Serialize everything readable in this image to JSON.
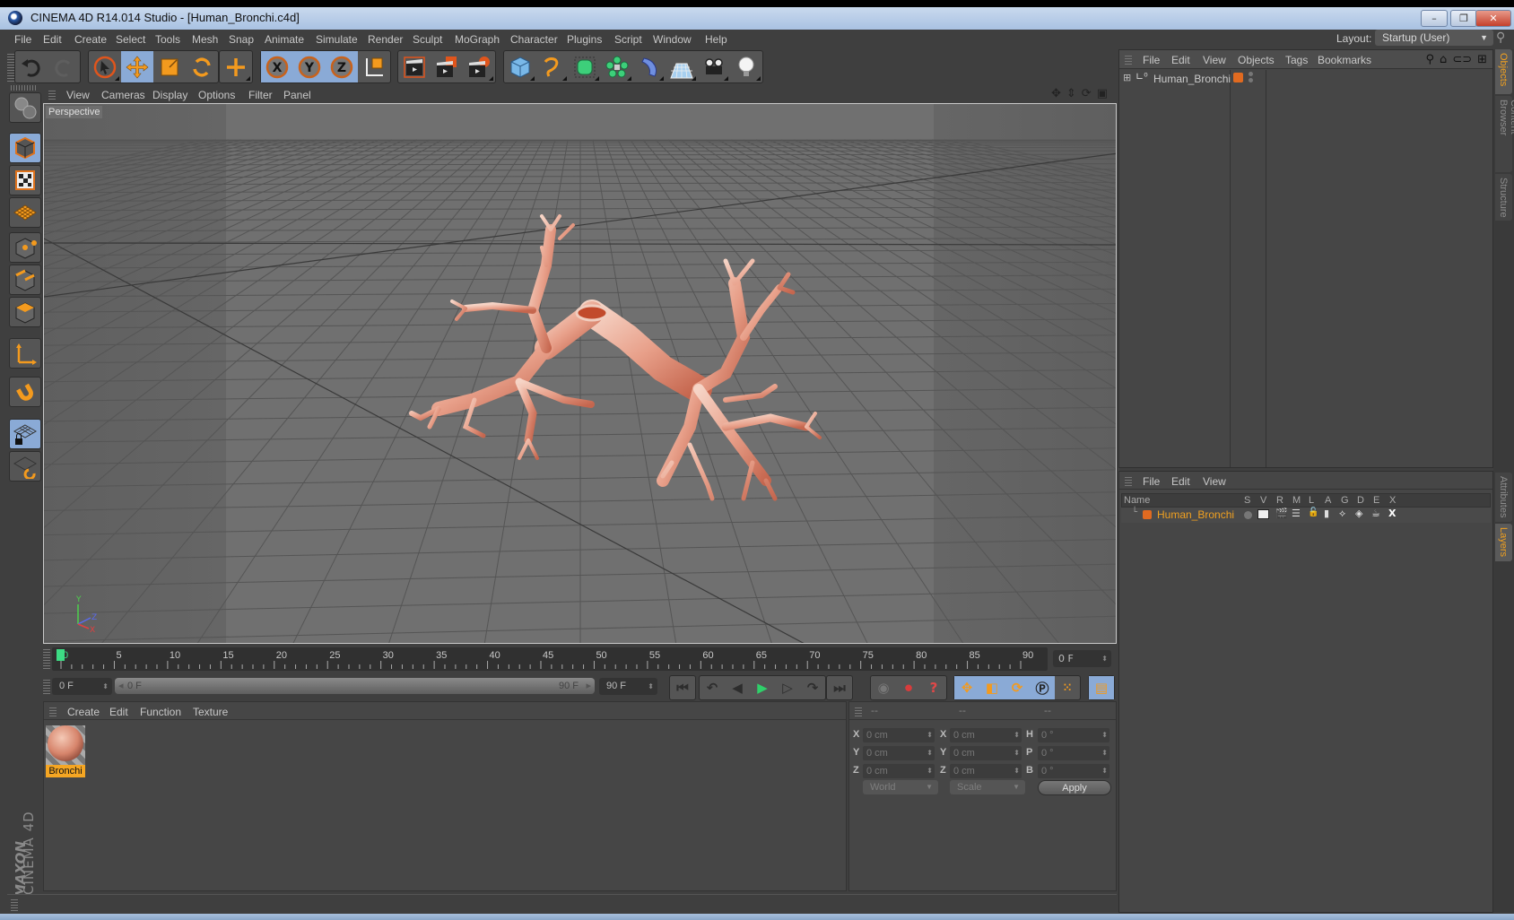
{
  "window": {
    "title": "CINEMA 4D R14.014 Studio - [Human_Bronchi.c4d]",
    "controls": {
      "minimize": "–",
      "restore": "❐",
      "close": "✕"
    }
  },
  "menubar": {
    "items": [
      "File",
      "Edit",
      "Create",
      "Select",
      "Tools",
      "Mesh",
      "Snap",
      "Animate",
      "Simulate",
      "Render",
      "Sculpt",
      "MoGraph",
      "Character",
      "Plugins",
      "Script",
      "Window",
      "Help"
    ],
    "layout_label": "Layout:",
    "layout_value": "Startup (User)"
  },
  "toolbar": {
    "groups": [
      {
        "name": "history",
        "buttons": [
          {
            "icon": "undo-icon",
            "active": false
          },
          {
            "icon": "redo-icon",
            "active": false
          }
        ]
      },
      {
        "name": "tools",
        "buttons": [
          {
            "icon": "live-selection-icon",
            "active": false
          },
          {
            "icon": "move-icon",
            "active": true
          },
          {
            "icon": "scale-icon",
            "active": false
          },
          {
            "icon": "rotate-icon",
            "active": false
          }
        ]
      },
      {
        "name": "recent",
        "buttons": [
          {
            "icon": "recent-tool-icon",
            "active": false
          }
        ]
      },
      {
        "name": "axis-lock",
        "buttons": [
          {
            "icon": "x-axis-icon",
            "active": true
          },
          {
            "icon": "y-axis-icon",
            "active": true
          },
          {
            "icon": "z-axis-icon",
            "active": true
          },
          {
            "icon": "coordinate-system-icon",
            "active": false
          }
        ]
      },
      {
        "name": "render",
        "buttons": [
          {
            "icon": "render-view-icon",
            "active": false
          },
          {
            "icon": "render-picture-viewer-icon",
            "active": false
          },
          {
            "icon": "render-settings-icon",
            "active": false
          }
        ]
      },
      {
        "name": "objects",
        "buttons": [
          {
            "icon": "cube-icon",
            "active": false
          },
          {
            "icon": "spline-pen-icon",
            "active": false
          },
          {
            "icon": "subdivision-icon",
            "active": false
          },
          {
            "icon": "cloner-icon",
            "active": false
          },
          {
            "icon": "deformer-icon",
            "active": false
          },
          {
            "icon": "floor-icon",
            "active": false
          },
          {
            "icon": "camera-icon",
            "active": false
          },
          {
            "icon": "light-icon",
            "active": false
          }
        ]
      }
    ]
  },
  "left_palette": {
    "buttons": [
      {
        "icon": "make-editable-icon",
        "active": false
      },
      {
        "icon": "model-mode-icon",
        "active": true
      },
      {
        "icon": "texture-mode-icon",
        "active": false
      },
      {
        "icon": "workplane-mode-icon",
        "active": false
      },
      {
        "icon": "points-mode-icon",
        "active": false
      },
      {
        "icon": "edges-mode-icon",
        "active": false
      },
      {
        "icon": "polygons-mode-icon",
        "active": false
      },
      {
        "icon": "axis-mode-icon",
        "active": false
      },
      {
        "icon": "snap-magnet-icon",
        "active": false
      },
      {
        "icon": "locked-workplane-icon",
        "active": true
      },
      {
        "icon": "workplane-align-icon",
        "active": false
      }
    ],
    "brand": "MAXON",
    "product": "CINEMA 4D"
  },
  "viewport": {
    "menu": [
      "View",
      "Cameras",
      "Display",
      "Options",
      "Filter",
      "Panel"
    ],
    "label": "Perspective",
    "nav_icons": [
      "pan-icon",
      "dolly-icon",
      "orbit-icon",
      "maximize-view-icon"
    ],
    "axis": {
      "x": "X",
      "y": "Y",
      "z": "Z"
    },
    "object": "Human_Bronchi"
  },
  "timeline": {
    "ticks": [
      "0",
      "5",
      "10",
      "15",
      "20",
      "25",
      "30",
      "35",
      "40",
      "45",
      "50",
      "55",
      "60",
      "65",
      "70",
      "75",
      "80",
      "85",
      "90"
    ],
    "current_frame_fraction": 0.0,
    "current_frame": "0 F",
    "start_field": "0 F",
    "range_start": "0 F",
    "range_end": "90 F",
    "end_field": "90 F",
    "playback": [
      "go-to-start-icon",
      "prev-key-icon",
      "prev-frame-icon",
      "play-icon",
      "next-frame-icon",
      "next-key-icon",
      "go-to-end-icon"
    ],
    "record": [
      "autokey-icon",
      "record-icon",
      "keyframe-selection-icon"
    ],
    "key_tracks": [
      {
        "icon": "position-key-icon",
        "active": true
      },
      {
        "icon": "scale-key-icon",
        "active": true
      },
      {
        "icon": "rotation-key-icon",
        "active": true
      },
      {
        "icon": "parameter-key-icon",
        "active": true
      },
      {
        "icon": "point-level-icon",
        "active": false
      }
    ],
    "scheme_icon": "timeline-scheme-icon"
  },
  "material_manager": {
    "menu": [
      "Create",
      "Edit",
      "Function",
      "Texture"
    ],
    "materials": [
      {
        "name": "Bronchi",
        "selected": true
      }
    ]
  },
  "coordinates": {
    "headers": [
      "--",
      "--",
      "--"
    ],
    "rows": [
      {
        "pos_label": "X",
        "pos": "0 cm",
        "size_label": "X",
        "size": "0 cm",
        "rot_label": "H",
        "rot": "0 °"
      },
      {
        "pos_label": "Y",
        "pos": "0 cm",
        "size_label": "Y",
        "size": "0 cm",
        "rot_label": "P",
        "rot": "0 °"
      },
      {
        "pos_label": "Z",
        "pos": "0 cm",
        "size_label": "Z",
        "size": "0 cm",
        "rot_label": "B",
        "rot": "0 °"
      }
    ],
    "space_dropdown": "World",
    "mode_dropdown": "Scale",
    "apply_label": "Apply"
  },
  "object_manager": {
    "menu": [
      "File",
      "Edit",
      "View",
      "Objects",
      "Tags",
      "Bookmarks"
    ],
    "tools": [
      "search-icon",
      "home-icon",
      "link-icon",
      "new-view-icon"
    ],
    "objects": [
      {
        "name": "Human_Bronchi",
        "layer_color": "#e06a20"
      }
    ]
  },
  "layer_manager": {
    "menu": [
      "File",
      "Edit",
      "View"
    ],
    "columns": [
      "Name",
      "S",
      "V",
      "R",
      "M",
      "L",
      "A",
      "G",
      "D",
      "E",
      "X"
    ],
    "layers": [
      {
        "name": "Human_Bronchi",
        "color": "#e06a20"
      }
    ]
  },
  "right_tabs": {
    "top": [
      {
        "label": "Objects",
        "active": true
      },
      {
        "label": "Content Browser",
        "active": false
      },
      {
        "label": "Structure",
        "active": false
      }
    ],
    "bottom": [
      {
        "label": "Attributes",
        "active": false
      },
      {
        "label": "Layers",
        "active": true
      }
    ]
  },
  "colors": {
    "accent_orange": "#f5a623",
    "active_blue": "#8aaad6",
    "layer_orange": "#e06a20",
    "playhead_green": "#3ddc84"
  }
}
